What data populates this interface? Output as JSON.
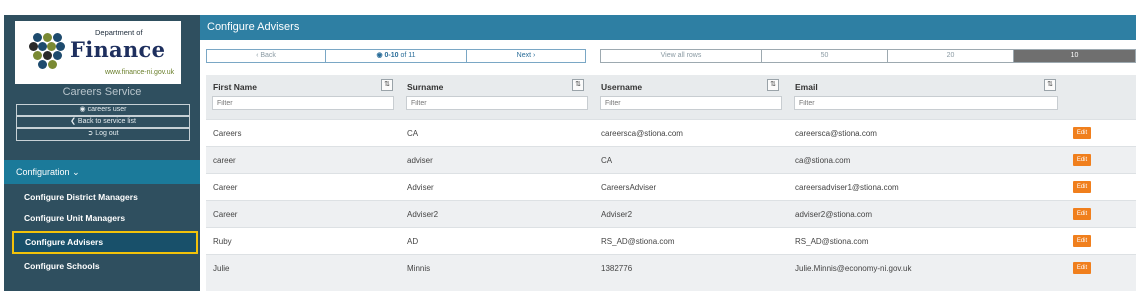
{
  "sidebar": {
    "logo": {
      "dept": "Department of",
      "name": "Finance",
      "url": "www.finance-ni.gov.uk"
    },
    "service_title": "Careers Service",
    "user_label": "careers user",
    "back_label": "Back to service list",
    "logout_label": "Log out",
    "config_label": "Configuration",
    "items": [
      {
        "label": "Configure District Managers"
      },
      {
        "label": "Configure Unit Managers"
      },
      {
        "label": "Configure Advisers",
        "active": true
      },
      {
        "label": "Configure Schools"
      }
    ]
  },
  "header": {
    "title": "Configure Advisers"
  },
  "pagination": {
    "back": "Back",
    "range": "0-10",
    "of": "of 11",
    "next": "Next",
    "sizes": [
      "View all rows",
      "50",
      "20",
      "10"
    ],
    "selected_size": "10"
  },
  "table": {
    "columns": [
      {
        "label": "First Name",
        "placeholder": "Filter"
      },
      {
        "label": "Surname",
        "placeholder": "Filter"
      },
      {
        "label": "Username",
        "placeholder": "Filter"
      },
      {
        "label": "Email",
        "placeholder": "Filter"
      }
    ],
    "edit_label": "Edit",
    "rows": [
      {
        "first": "Careers",
        "surname": "CA",
        "username": "careersca@stiona.com",
        "email": "careersca@stiona.com"
      },
      {
        "first": "career",
        "surname": "adviser",
        "username": "CA",
        "email": "ca@stiona.com"
      },
      {
        "first": "Career",
        "surname": "Adviser",
        "username": "CareersAdviser",
        "email": "careersadviser1@stiona.com"
      },
      {
        "first": "Career",
        "surname": "Adviser2",
        "username": "Adviser2",
        "email": "adviser2@stiona.com"
      },
      {
        "first": "Ruby",
        "surname": "AD",
        "username": "RS_AD@stiona.com",
        "email": "RS_AD@stiona.com"
      },
      {
        "first": "Julie",
        "surname": "Minnis",
        "username": "1382776",
        "email": "Julie.Minnis@economy-ni.gov.uk"
      }
    ]
  },
  "colors": {
    "sidebar": "#2f4f5f",
    "header": "#2e7fa3",
    "accent": "#1b7a9a",
    "edit": "#f07f1d",
    "highlight": "#f2c20a"
  }
}
